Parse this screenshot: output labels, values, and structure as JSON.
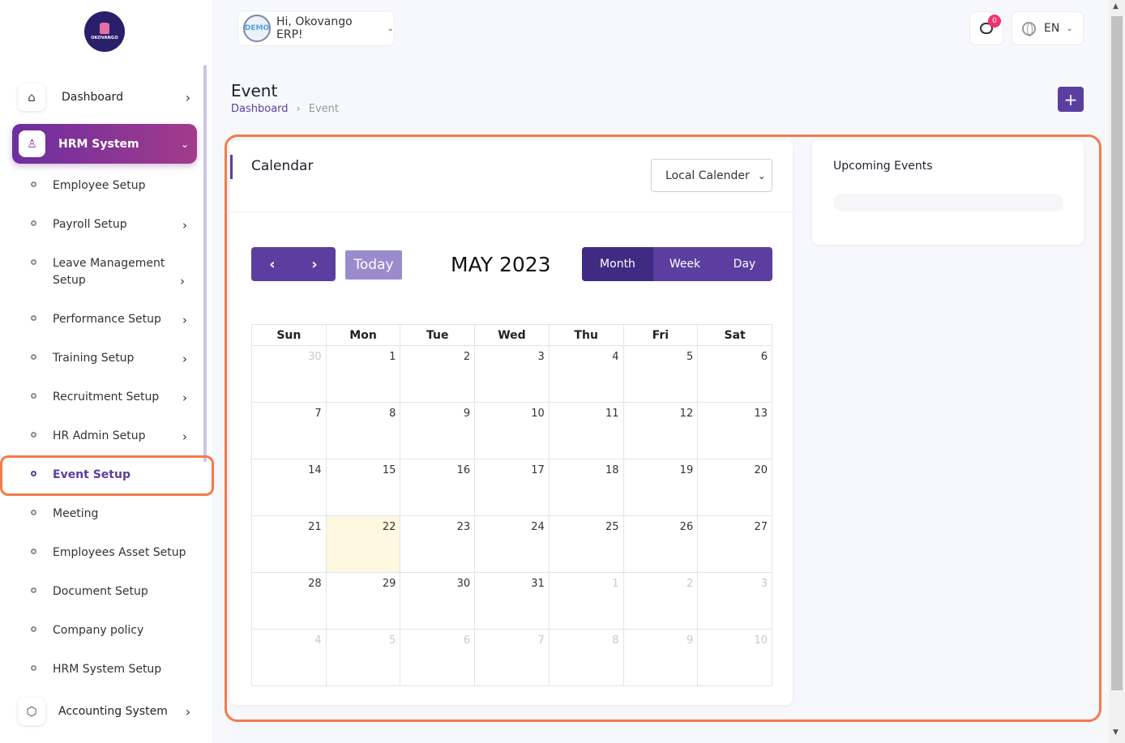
{
  "brand": {
    "logo_text": "OKOVANGO"
  },
  "sidebar": {
    "dashboard": {
      "label": "Dashboard"
    },
    "hrm": {
      "label": "HRM System"
    },
    "items": [
      {
        "label": "Employee Setup",
        "has_children": false
      },
      {
        "label": "Payroll Setup",
        "has_children": true
      },
      {
        "label": "Leave Management Setup",
        "has_children": true
      },
      {
        "label": "Performance Setup",
        "has_children": true
      },
      {
        "label": "Training Setup",
        "has_children": true
      },
      {
        "label": "Recruitment Setup",
        "has_children": true
      },
      {
        "label": "HR Admin Setup",
        "has_children": true
      },
      {
        "label": "Event Setup",
        "has_children": false,
        "active": true
      },
      {
        "label": "Meeting",
        "has_children": false
      },
      {
        "label": "Employees Asset Setup",
        "has_children": false
      },
      {
        "label": "Document Setup",
        "has_children": false
      },
      {
        "label": "Company policy",
        "has_children": false
      },
      {
        "label": "HRM System Setup",
        "has_children": false
      }
    ],
    "accounting": {
      "label": "Accounting System"
    }
  },
  "header": {
    "avatar_text": "DEMO",
    "greeting": "Hi, Okovango ERP!",
    "notification_count": "0",
    "language": "EN"
  },
  "page": {
    "title": "Event",
    "breadcrumb": [
      "Dashboard",
      "Event"
    ],
    "add_button": "+"
  },
  "calendar": {
    "card_title": "Calendar",
    "calendar_select": "Local Calender",
    "today_label": "Today",
    "month_title": "MAY 2023",
    "views": [
      "Month",
      "Week",
      "Day"
    ],
    "active_view": "Month",
    "weekdays": [
      "Sun",
      "Mon",
      "Tue",
      "Wed",
      "Thu",
      "Fri",
      "Sat"
    ],
    "weeks": [
      [
        {
          "d": "30",
          "o": true
        },
        {
          "d": "1"
        },
        {
          "d": "2"
        },
        {
          "d": "3"
        },
        {
          "d": "4"
        },
        {
          "d": "5"
        },
        {
          "d": "6"
        }
      ],
      [
        {
          "d": "7"
        },
        {
          "d": "8"
        },
        {
          "d": "9"
        },
        {
          "d": "10"
        },
        {
          "d": "11"
        },
        {
          "d": "12"
        },
        {
          "d": "13"
        }
      ],
      [
        {
          "d": "14"
        },
        {
          "d": "15"
        },
        {
          "d": "16"
        },
        {
          "d": "17"
        },
        {
          "d": "18"
        },
        {
          "d": "19"
        },
        {
          "d": "20"
        }
      ],
      [
        {
          "d": "21"
        },
        {
          "d": "22",
          "t": true
        },
        {
          "d": "23"
        },
        {
          "d": "24"
        },
        {
          "d": "25"
        },
        {
          "d": "26"
        },
        {
          "d": "27"
        }
      ],
      [
        {
          "d": "28"
        },
        {
          "d": "29"
        },
        {
          "d": "30"
        },
        {
          "d": "31"
        },
        {
          "d": "1",
          "o": true
        },
        {
          "d": "2",
          "o": true
        },
        {
          "d": "3",
          "o": true
        }
      ],
      [
        {
          "d": "4",
          "o": true
        },
        {
          "d": "5",
          "o": true
        },
        {
          "d": "6",
          "o": true
        },
        {
          "d": "7",
          "o": true
        },
        {
          "d": "8",
          "o": true
        },
        {
          "d": "9",
          "o": true
        },
        {
          "d": "10",
          "o": true
        }
      ]
    ]
  },
  "upcoming": {
    "title": "Upcoming Events"
  },
  "colors": {
    "accent": "#5b3fa0",
    "highlight": "#f47a4a",
    "today_bg": "#fdf8df"
  }
}
